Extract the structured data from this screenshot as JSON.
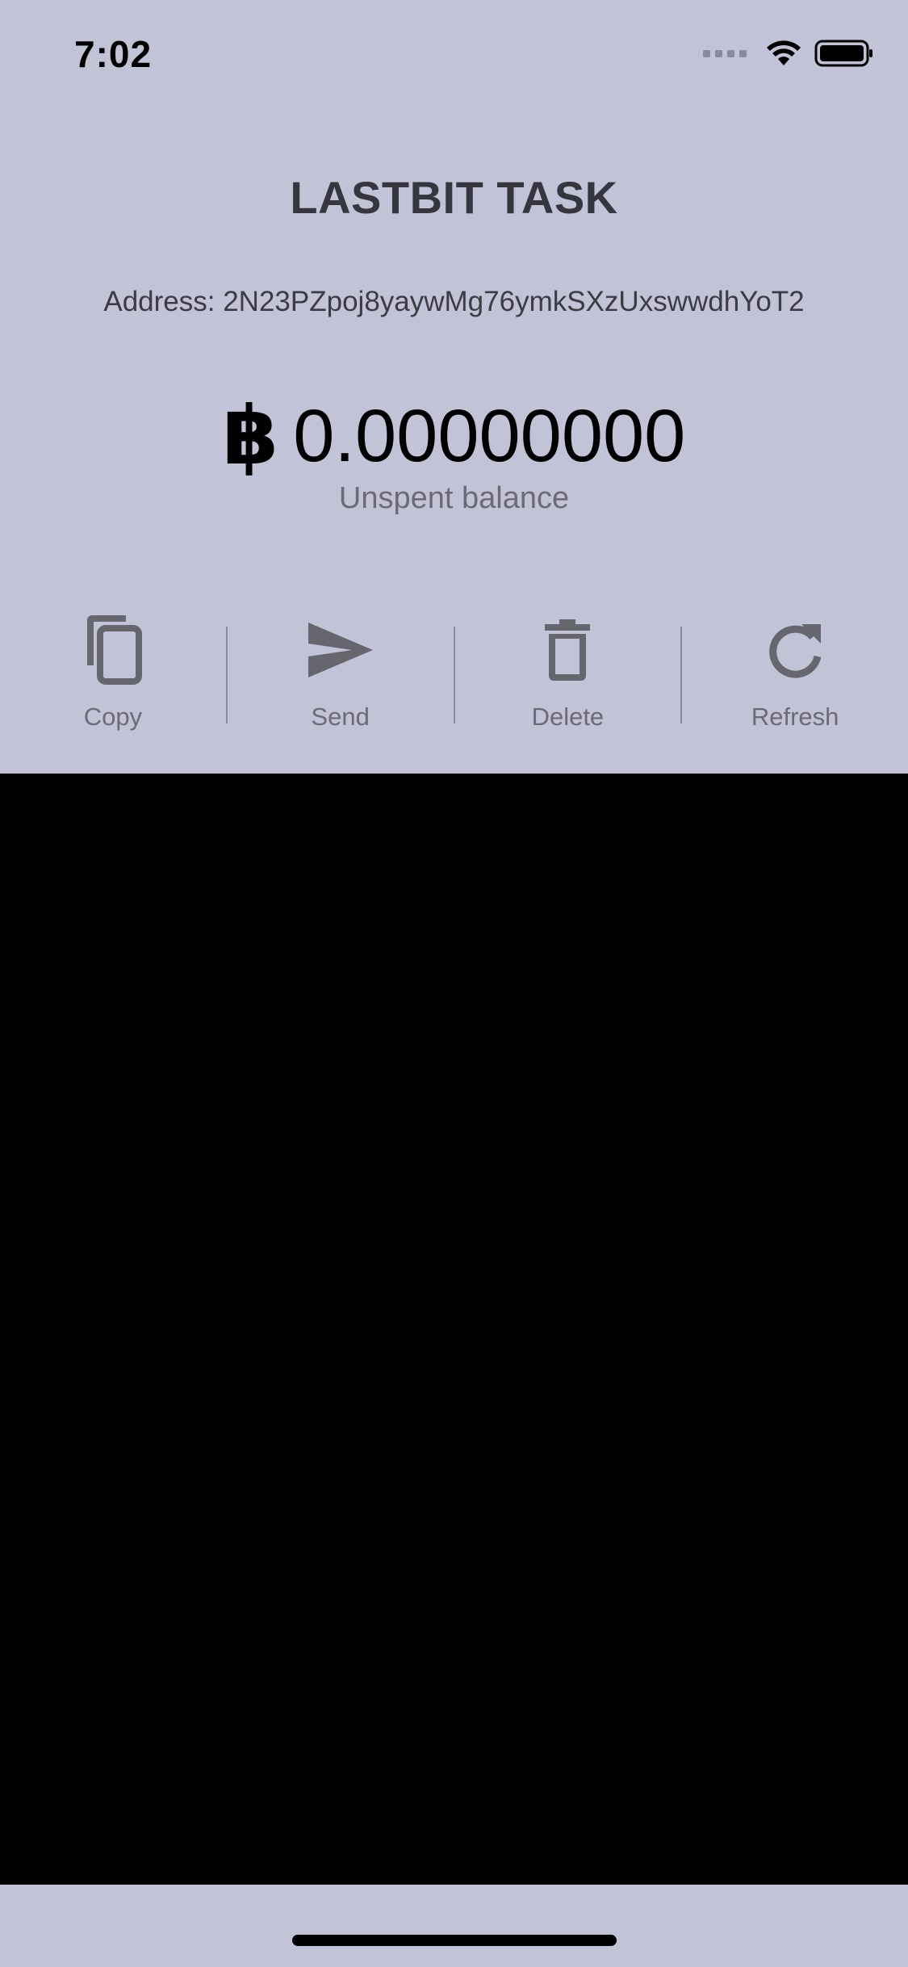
{
  "status_bar": {
    "time": "7:02",
    "icons": [
      "signal-icon",
      "wifi-icon",
      "battery-icon"
    ]
  },
  "header": {
    "title": "LASTBIT TASK"
  },
  "wallet": {
    "address_label": "Address:",
    "address_value": "2N23PZpoj8yaywMg76ymkSXzUxswwdhYoT2",
    "currency_symbol": "฿",
    "balance": "0.00000000",
    "balance_caption": "Unspent balance"
  },
  "actions": [
    {
      "label": "Copy",
      "icon": "copy-icon"
    },
    {
      "label": "Send",
      "icon": "send-icon"
    },
    {
      "label": "Delete",
      "icon": "trash-icon"
    },
    {
      "label": "Refresh",
      "icon": "refresh-icon"
    }
  ],
  "colors": {
    "background": "#c3c3d7",
    "title_text": "#36363f",
    "secondary_text": "#6b6b76",
    "icon_color": "#66666f",
    "content_area": "#000000"
  }
}
